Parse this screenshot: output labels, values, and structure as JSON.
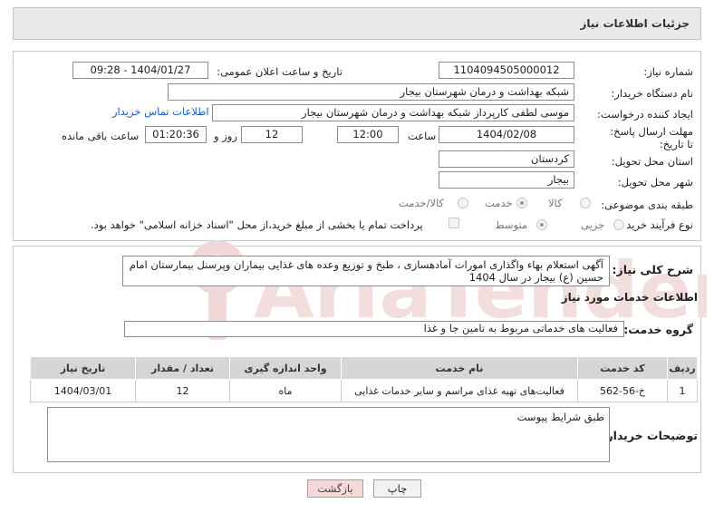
{
  "header": {
    "title": "جزئیات اطلاعات نیاز"
  },
  "form": {
    "need_number": {
      "label": "شماره نیاز:",
      "value": "1104094505000012"
    },
    "announce_datetime": {
      "label": "تاریخ و ساعت اعلان عمومی:",
      "value": "1404/01/27 - 09:28"
    },
    "buyer_org": {
      "label": "نام دستگاه خریدار:",
      "value": "شبکه بهداشت و درمان شهرستان بیجار"
    },
    "requester": {
      "label": "ایجاد کننده درخواست:",
      "value": "موسی لطفی کارپرداز شبکه بهداشت و درمان شهرستان بیجار",
      "contact_link": "اطلاعات تماس خریدار"
    },
    "deadline": {
      "label": "مهلت ارسال پاسخ: تا تاریخ:",
      "date": "1404/02/08",
      "time_label": "ساعت",
      "time": "12:00",
      "days": "12",
      "days_label": "روز و",
      "remaining": "01:20:36",
      "remaining_label": "ساعت باقی مانده"
    },
    "province": {
      "label": "استان محل تحویل:",
      "value": "کردستان"
    },
    "city": {
      "label": "شهر محل تحویل:",
      "value": "بیجار"
    },
    "category": {
      "label": "طبقه بندی موضوعی:",
      "options": [
        "کالا",
        "خدمت",
        "کالا/خدمت"
      ],
      "selected": "خدمت"
    },
    "process": {
      "label": "نوع فرآیند خرید :",
      "options": [
        "جزیی",
        "متوسط"
      ],
      "selected": "متوسط",
      "payment_note": "پرداخت تمام یا بخشی از مبلغ خرید،از محل \"اسناد خزانه اسلامی\" خواهد بود."
    }
  },
  "summary": {
    "label": "شرح کلی نیاز:",
    "text": "آگهی  استعلام بهاء واگذاری امورات آمادهسازی ، طبخ و توزیع وعده های غذایی بیماران وپرسنل  بیمارستان امام حسین (ع) بیجار در سال 1404"
  },
  "services": {
    "section_title": "اطلاعات خدمات مورد نیاز",
    "group_label": "گروه خدمت:",
    "group_value": "فعالیت های خدماتی مربوط به تامین جا و غذا",
    "columns": [
      "ردیف",
      "کد خدمت",
      "نام خدمت",
      "واحد اندازه گیری",
      "تعداد / مقدار",
      "تاریخ نیاز"
    ],
    "rows": [
      [
        "1",
        "خ-56-562",
        "فعالیت‌های تهیه غذای مراسم و سایر خدمات غذایی",
        "ماه",
        "12",
        "1404/03/01"
      ]
    ]
  },
  "buyer_notes": {
    "label": "توضیحات خریدار:",
    "text": "طبق شرایط پیوست"
  },
  "buttons": {
    "print": "چاپ",
    "back": "بازگشت"
  },
  "watermark": {
    "text": "AriaTender.net"
  }
}
